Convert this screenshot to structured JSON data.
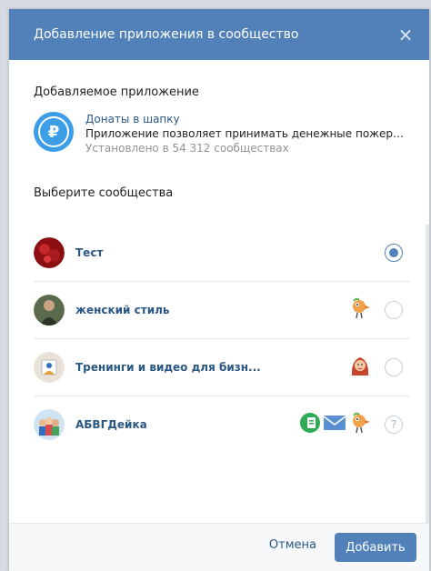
{
  "window": {
    "title": "Добавление приложения в сообщество"
  },
  "app_section": {
    "title": "Добавляемое приложение",
    "icon": "ruble-icon",
    "name": "Донаты в шапку",
    "description": "Приложение позволяет принимать денежные пожертв...",
    "installs": "Установлено в 54 312 сообществах"
  },
  "communities": {
    "title": "Выберите сообщества",
    "items": [
      {
        "name": "Тест",
        "state": "selected",
        "badges": []
      },
      {
        "name": "женский стиль",
        "state": "unselected",
        "badges": [
          "bird-icon"
        ]
      },
      {
        "name": "Тренинги и видео для бизн...",
        "state": "unselected",
        "badges": [
          "girl-avatar-icon"
        ]
      },
      {
        "name": "АБВГДейка",
        "state": "help",
        "badges": [
          "green-app-icon",
          "envelope-icon",
          "bird-icon"
        ],
        "help_label": "?"
      }
    ]
  },
  "footer": {
    "cancel_label": "Отмена",
    "add_label": "Добавить"
  },
  "colors": {
    "accent": "#5181b8",
    "link": "#2a5885",
    "muted": "#939393",
    "app_icon": "#3d9ee8"
  }
}
